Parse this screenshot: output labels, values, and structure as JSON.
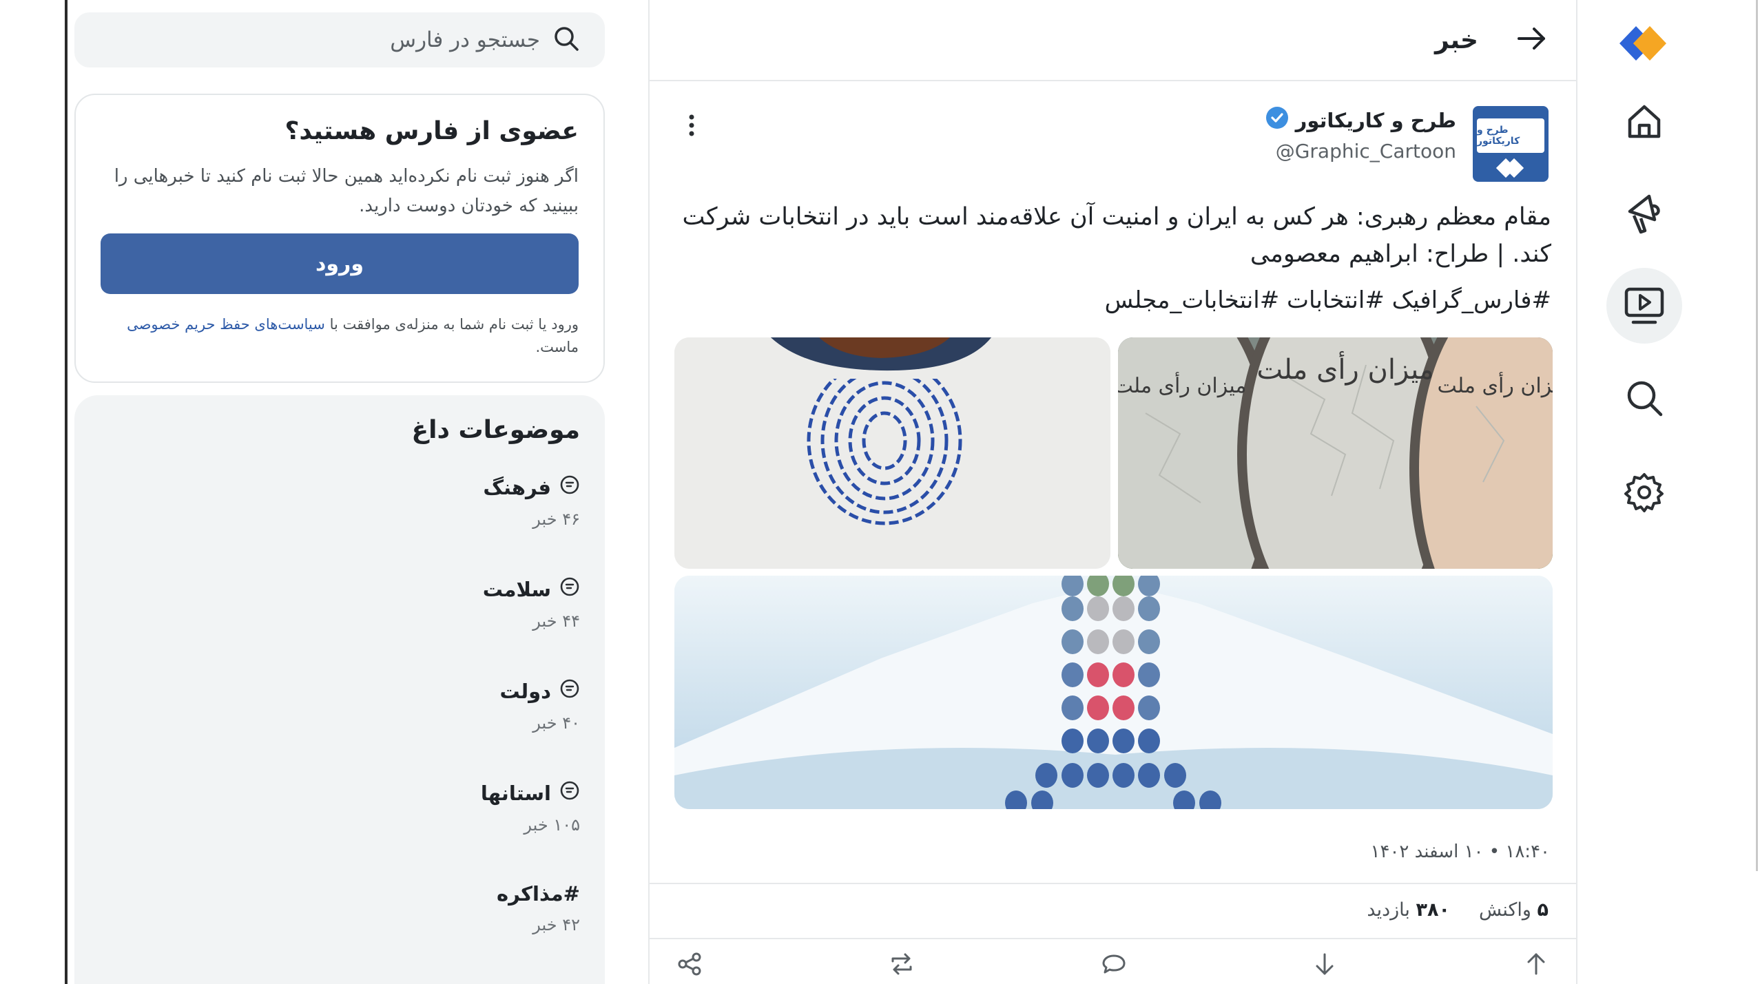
{
  "search": {
    "placeholder": "جستجو در فارس"
  },
  "join_card": {
    "title": "عضوی از فارس هستید؟",
    "description": "اگر هنوز ثبت نام نکرده‌اید همین حالا ثبت نام کنید تا خبرهایی را ببینید که خودتان دوست دارید.",
    "login_button": "ورود",
    "terms_prefix": "ورود یا ثبت نام شما به منزله‌ی موافقت با",
    "terms_link": "سیاست‌های حفظ حریم خصوصی",
    "terms_suffix": "ماست."
  },
  "trending": {
    "title": "موضوعات داغ",
    "items": [
      {
        "label": "فرهنگ",
        "count": "۴۶ خبر",
        "icon": "chat-bubble-icon"
      },
      {
        "label": "سلامت",
        "count": "۴۴ خبر",
        "icon": "chat-bubble-icon"
      },
      {
        "label": "دولت",
        "count": "۴۰ خبر",
        "icon": "chat-bubble-icon"
      },
      {
        "label": "استانها",
        "count": "۱۰۵ خبر",
        "icon": "chat-bubble-icon"
      },
      {
        "label": "#مذاکره",
        "count": "۴۲ خبر",
        "icon": ""
      }
    ]
  },
  "header": {
    "title": "خبر"
  },
  "post": {
    "author_name": "طرح و کاریکاتور",
    "author_handle": "@Graphic_Cartoon",
    "avatar_text": "طرح و کاریکاتور",
    "body": "مقام معظم رهبری: هر کس به ایران و امنیت آن علاقه‌مند است باید در انتخابات شرکت کند. | طراح: ابراهیم معصومی",
    "hashtags": "#فارس_گرافیک #انتخابات #انتخابات_مجلس",
    "timestamp": "۱۸:۴۰ • ۱۰ اسفند ۱۴۰۲",
    "reactions_count": "۵",
    "reactions_label": "واکنش",
    "views_count": "۳۸۰",
    "views_label": "بازدید",
    "image_text": "میزان رأی ملت"
  },
  "colors": {
    "accent": "#3e64a4",
    "verified": "#3d8fe0",
    "logo_blue": "#2e64d8",
    "logo_orange": "#f5a623"
  }
}
